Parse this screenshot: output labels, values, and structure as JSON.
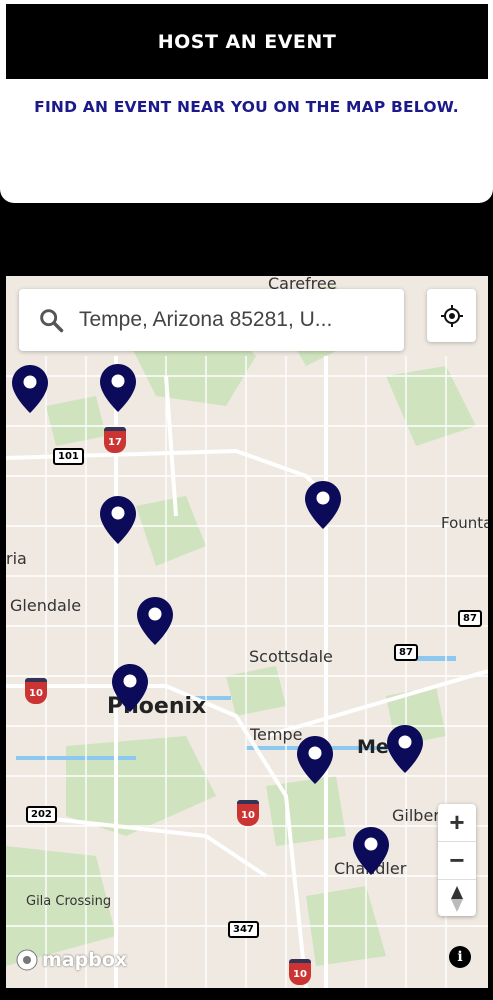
{
  "header": {
    "host_button": "HOST AN EVENT",
    "find_text": "FIND AN EVENT NEAR YOU ON THE MAP BELOW."
  },
  "map": {
    "search": {
      "value": "Tempe, Arizona 85281, U..."
    },
    "labels": {
      "carefree": "Carefree",
      "fountain": "Founta",
      "peoria": "ria",
      "glendale": "Glendale",
      "scottsdale": "Scottsdale",
      "phoenix": "Phoenix",
      "tempe": "Tempe",
      "mesa": "Mes",
      "gilbert": "Gilber",
      "chandler": "Chandler",
      "gila": "Gila Crossing"
    },
    "shields": {
      "s101": "101",
      "s17": "17",
      "s87a": "87",
      "s87b": "87",
      "s10a": "10",
      "s10b": "10",
      "s10c": "10",
      "s202": "202",
      "s347": "347"
    },
    "attribution": "mapbox",
    "zoom_in": "+",
    "zoom_out": "−",
    "pin_color": "#0b0b5a"
  }
}
